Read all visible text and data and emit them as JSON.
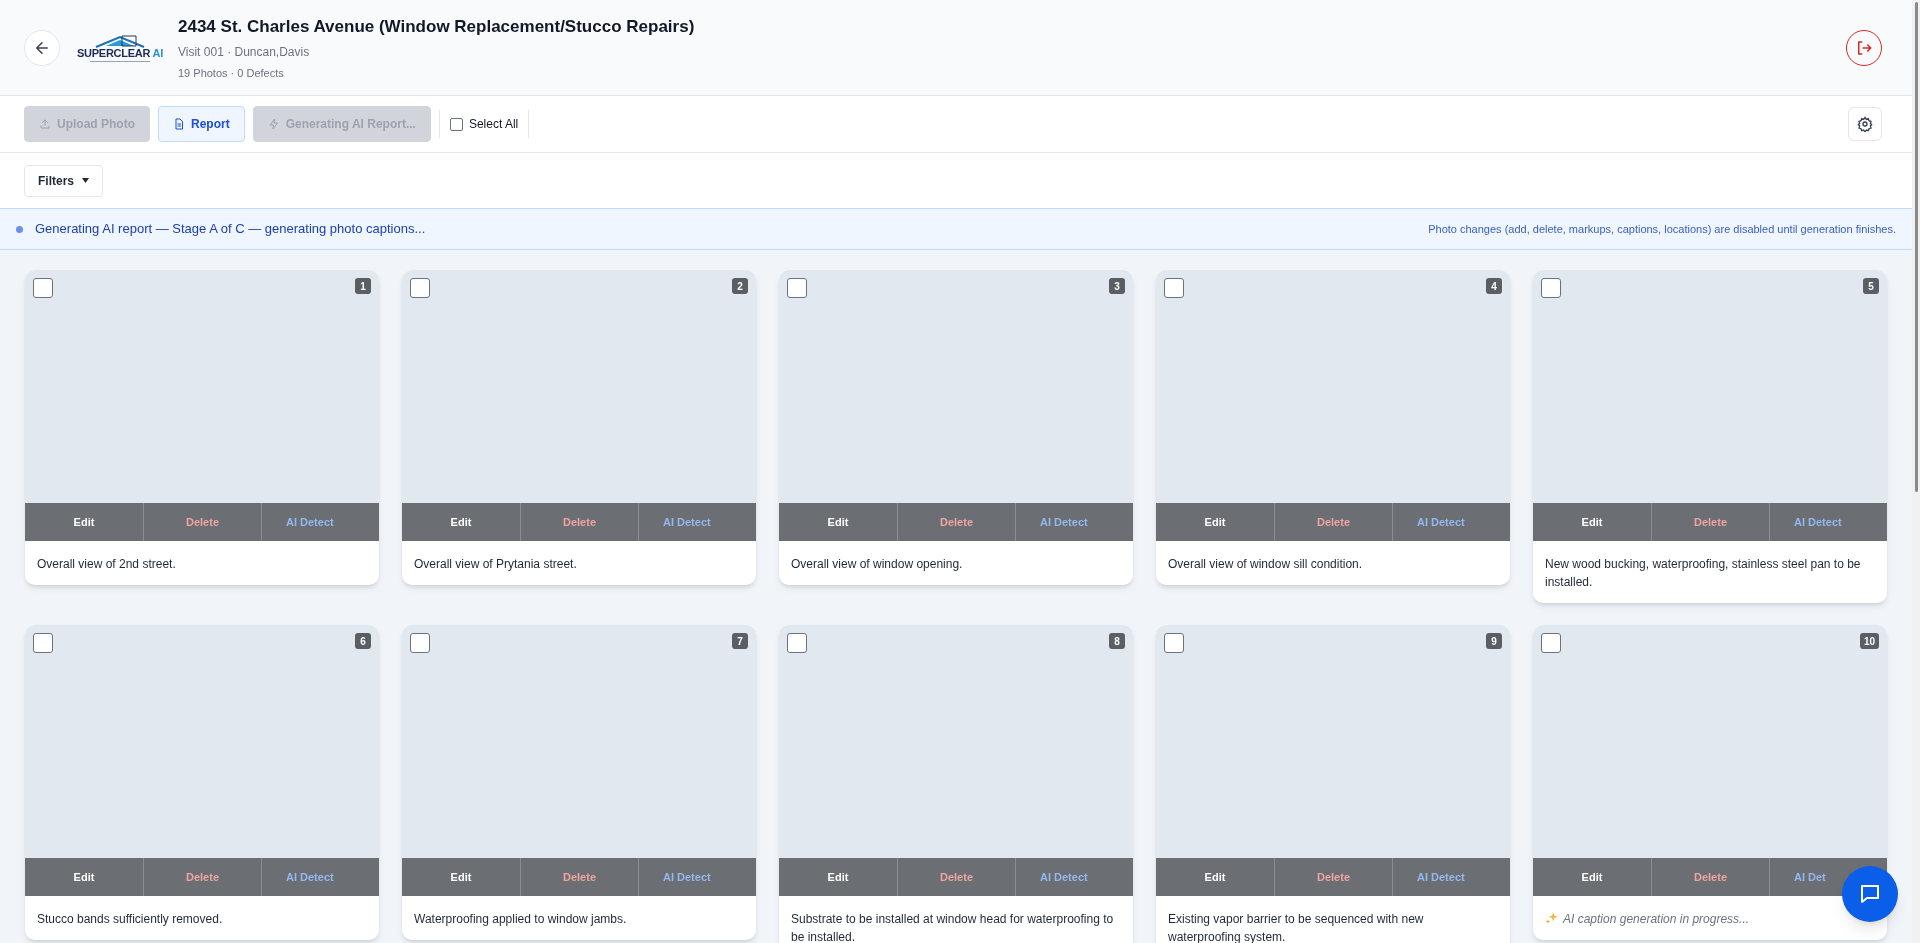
{
  "header": {
    "logo": {
      "name": "SUPERCLEAR",
      "suffix": "AI"
    },
    "title": "2434 St. Charles Avenue (Window Replacement/Stucco Repairs)",
    "subtitle": "Visit 001 · Duncan,Davis",
    "stats": "19 Photos · 0 Defects"
  },
  "toolbar": {
    "buttons": [
      {
        "label": "Upload Photo",
        "kind": "upload",
        "disabled": true
      },
      {
        "label": "Report",
        "kind": "report",
        "disabled": false
      },
      {
        "label": "Generating AI Report...",
        "kind": "generate",
        "disabled": true
      }
    ],
    "select_all": {
      "label": "Select All",
      "checked": false
    }
  },
  "filters": {
    "label": "Filters"
  },
  "banner": {
    "message": "Generating AI report — Stage A of C — generating photo captions...",
    "note": "Photo changes (add, delete, markups, captions, locations) are disabled until generation finishes."
  },
  "photos": [
    {
      "number": "1",
      "checked": false,
      "caption": "Overall view of 2nd street.",
      "caption_pending": false,
      "actions": [
        "Edit",
        "Delete",
        "AI Detect"
      ]
    },
    {
      "number": "2",
      "checked": false,
      "caption": "Overall view of Prytania street.",
      "caption_pending": false,
      "actions": [
        "Edit",
        "Delete",
        "AI Detect"
      ]
    },
    {
      "number": "3",
      "checked": false,
      "caption": "Overall view of window opening.",
      "caption_pending": false,
      "actions": [
        "Edit",
        "Delete",
        "AI Detect"
      ]
    },
    {
      "number": "4",
      "checked": false,
      "caption": "Overall view of window sill condition.",
      "caption_pending": false,
      "actions": [
        "Edit",
        "Delete",
        "AI Detect"
      ]
    },
    {
      "number": "5",
      "checked": false,
      "caption": "New wood bucking, waterproofing, stainless steel pan to be installed.",
      "caption_pending": false,
      "actions": [
        "Edit",
        "Delete",
        "AI Detect"
      ]
    },
    {
      "number": "6",
      "checked": false,
      "caption": "Stucco bands sufficiently removed.",
      "caption_pending": false,
      "actions": [
        "Edit",
        "Delete",
        "AI Detect"
      ]
    },
    {
      "number": "7",
      "checked": false,
      "caption": "Waterproofing applied to window jambs.",
      "caption_pending": false,
      "actions": [
        "Edit",
        "Delete",
        "AI Detect"
      ]
    },
    {
      "number": "8",
      "checked": false,
      "caption": "Substrate to be installed at window head for waterproofing to be installed.",
      "caption_pending": false,
      "actions": [
        "Edit",
        "Delete",
        "AI Detect"
      ]
    },
    {
      "number": "9",
      "checked": false,
      "caption": "Existing vapor barrier to be sequenced with new waterproofing system.",
      "caption_pending": false,
      "actions": [
        "Edit",
        "Delete",
        "AI Detect"
      ]
    },
    {
      "number": "10",
      "checked": false,
      "caption": "AI caption generation in progress...",
      "caption_pending": true,
      "actions": [
        "Edit",
        "Delete",
        "AI Det"
      ]
    }
  ]
}
